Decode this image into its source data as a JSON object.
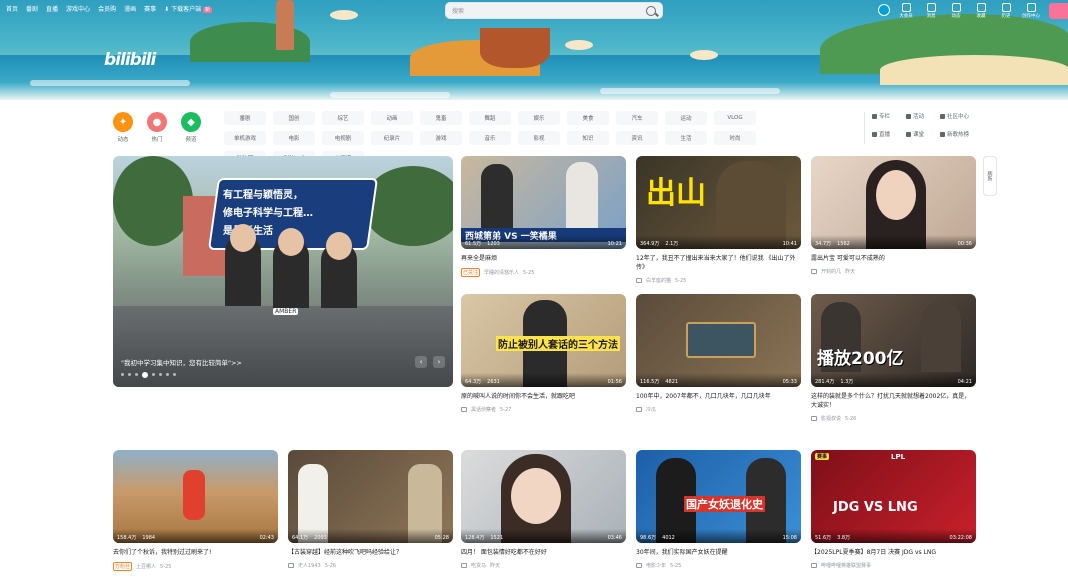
{
  "header": {
    "nav": [
      "首页",
      "番剧",
      "直播",
      "游戏中心",
      "会员购",
      "漫画",
      "赛事"
    ],
    "download": "下载客户端",
    "download_badge": "新",
    "search_placeholder": "搜索",
    "right_nav": [
      "大会员",
      "消息",
      "动态",
      "收藏",
      "历史",
      "创作中心"
    ],
    "logo": "bilibili"
  },
  "quick_entries": [
    {
      "label": "动态",
      "icon": "dynamic-icon"
    },
    {
      "label": "热门",
      "icon": "hot-icon"
    },
    {
      "label": "频道",
      "icon": "channel-icon"
    }
  ],
  "channels": [
    "番剧",
    "国创",
    "综艺",
    "动画",
    "鬼畜",
    "舞蹈",
    "娱乐",
    "美食",
    "汽车",
    "运动",
    "VLOG",
    "单机游戏",
    "电影",
    "电视剧",
    "纪录片",
    "游戏",
    "音乐",
    "影视",
    "知识",
    "资讯",
    "生活",
    "时尚",
    "动物圈",
    "虚拟UP主",
    "公开课"
  ],
  "side_links": [
    "专栏",
    "活动",
    "社区中心",
    "直播",
    "课堂",
    "新歌热榜"
  ],
  "float_button": "刷新",
  "carousel": {
    "bubble_lines": [
      "有工程与颖悟灵，",
      "修电子科学与工程…",
      "是最新生活"
    ],
    "caption": "\"我初中学习集中知识，您有比较简单\">>",
    "badge": "AMBER",
    "prev": "‹",
    "next": "›"
  },
  "cards": [
    {
      "title": "再来全是麻烦",
      "overlay": "西城第弟 VS 一笑橘果",
      "views": "61.5万",
      "danmaku": "1203",
      "duration": "10:21",
      "tag": "已关注",
      "author": "早睡的清悠乐人",
      "date": "5-25"
    },
    {
      "title": "12年了，我丑不了撞出来当来大家了！他们说我 《出山了外传》",
      "overlay": "出山",
      "views": "364.9万",
      "danmaku": "2.1万",
      "duration": "10:41",
      "tag": "",
      "author": "白羊座的猫",
      "date": "5-25"
    },
    {
      "title": "露出片宝 可爱可以不成熟的",
      "overlay": "",
      "views": "34.7万",
      "danmaku": "1562",
      "duration": "00:36",
      "tag": "",
      "author": "开封的几",
      "date": "昨天"
    },
    {
      "title": "原的喊叫人说的时间你不会生活，就跟吃吧",
      "overlay": "防止被别人套话的三个方法",
      "views": "64.3万",
      "danmaku": "2631",
      "duration": "01:56",
      "tag": "",
      "author": "黑话侦察者",
      "date": "5-27"
    },
    {
      "title": "100年中，2007年都不，几口几块年，几口几块年",
      "overlay": "",
      "views": "116.5万",
      "danmaku": "4821",
      "duration": "05:33",
      "tag": "",
      "author": "冷瓜",
      "date": ""
    },
    {
      "title": "这样的装就是多个什么？打扰几天就就想着2002亿，真是，大诚实！",
      "overlay": "播放200亿",
      "views": "281.4万",
      "danmaku": "1.3万",
      "duration": "04:21",
      "tag": "",
      "author": "影视叔说",
      "date": "5-26"
    },
    {
      "title": "去你们了个秋诉，我特别过过刷来了!",
      "overlay": "",
      "views": "158.4万",
      "danmaku": "1984",
      "duration": "02:43",
      "tag": "万粉丝",
      "author": "土豆哪人",
      "date": "5-25"
    },
    {
      "title": "【古装穿越】经前这种吹飞吧吗经验给让？",
      "overlay": "",
      "views": "64.1万",
      "danmaku": "2093",
      "duration": "05:28",
      "tag": "",
      "author": "无人1943",
      "date": "5-26"
    },
    {
      "title": "四月！ 面包装情好吃都不在好好",
      "overlay": "",
      "views": "128.4万",
      "danmaku": "1521",
      "duration": "03:46",
      "tag": "",
      "author": "吃货马",
      "date": "昨天"
    },
    {
      "title": "30年间，我们实际国产女妖在提醒",
      "overlay": "国产女妖退化史",
      "views": "98.6万",
      "danmaku": "4012",
      "duration": "15:08",
      "tag": "",
      "author": "电影少年",
      "date": "5-25"
    },
    {
      "title": "【2025LPL夏季赛】8月7日 决赛 JDG vs LNG",
      "overlay": "JDG VS LNG",
      "views": "51.6万",
      "danmaku": "3.8万",
      "duration": "03:22:08",
      "tag": "",
      "author": "哔哩哔哩英雄联盟赛事",
      "date": "",
      "badge": "赛事",
      "league": "LPL"
    }
  ],
  "colors": {
    "accent": "#fb7299",
    "bili_blue": "#00a1d6",
    "text": "#18191c",
    "muted": "#9499a0"
  }
}
